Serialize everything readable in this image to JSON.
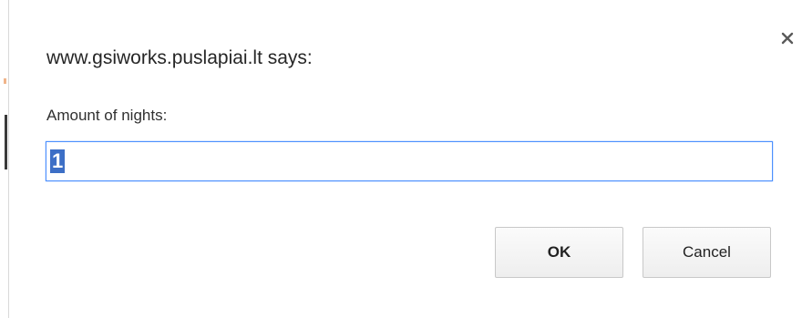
{
  "dialog": {
    "title": "www.gsiworks.puslapiai.lt says:",
    "prompt_label": "Amount of nights:",
    "input_value": "1",
    "ok_label": "OK",
    "cancel_label": "Cancel",
    "close_icon": "close-icon"
  },
  "colors": {
    "focus_border": "#4d90fe",
    "selection": "#3d6fc6"
  }
}
